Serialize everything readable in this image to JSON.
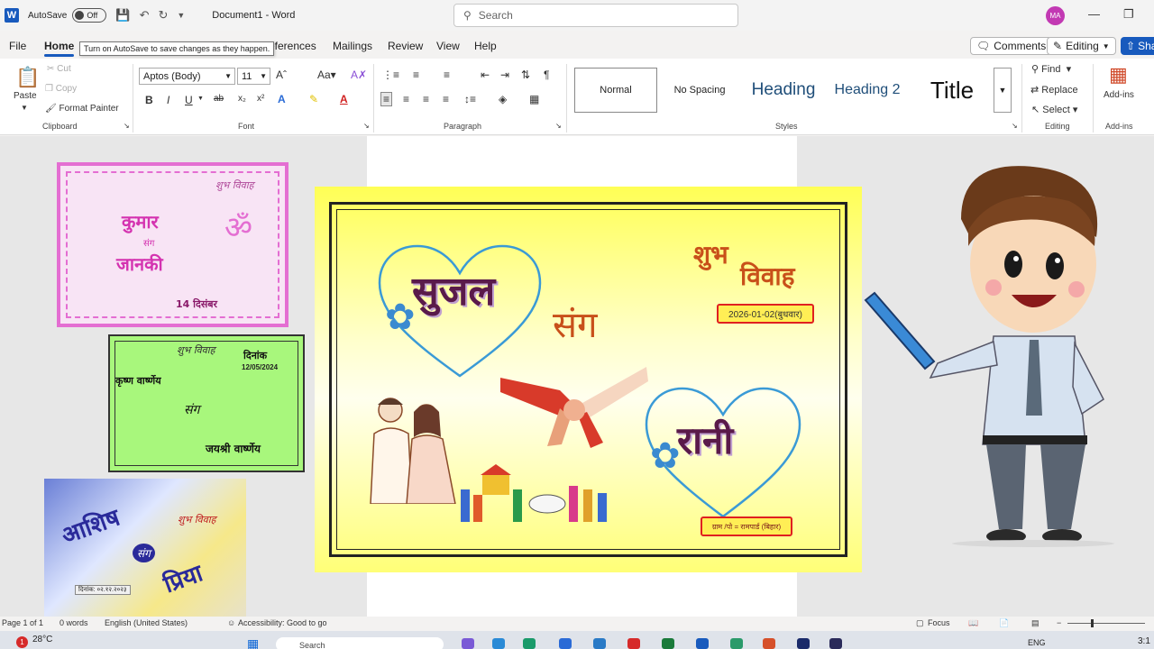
{
  "titlebar": {
    "autosave_label": "AutoSave",
    "autosave_state": "Off",
    "document_title": "Document1 - Word",
    "search_placeholder": "Search",
    "user_initials": "MA"
  },
  "tooltip": "Turn on AutoSave to save changes as they happen.",
  "menu": {
    "tabs": [
      "File",
      "Home",
      "References",
      "Mailings",
      "Review",
      "View",
      "Help"
    ],
    "references_visible_fragment": "eferences",
    "active": "Home",
    "comments_label": "Comments",
    "editing_label": "Editing",
    "share_label": "Sha"
  },
  "ribbon": {
    "clipboard": {
      "label": "Clipboard",
      "paste": "Paste",
      "cut": "Cut",
      "copy": "Copy",
      "format_painter": "Format Painter"
    },
    "font": {
      "label": "Font",
      "family": "Aptos (Body)",
      "size": "11"
    },
    "paragraph": {
      "label": "Paragraph"
    },
    "styles": {
      "label": "Styles",
      "items": [
        "Normal",
        "No Spacing",
        "Heading",
        "Heading 2",
        "Title"
      ]
    },
    "editing": {
      "label": "Editing",
      "find": "Find",
      "replace": "Replace",
      "select": "Select"
    },
    "addins": {
      "button": "Add-ins",
      "label": "Add-ins"
    }
  },
  "cards": {
    "pink": {
      "top_right": "शुभ विवाह",
      "groom": "कुमार",
      "joiner": "संग",
      "bride": "जानकी",
      "date": "14 दिसंबर"
    },
    "green": {
      "heading": "शुभ विवाह",
      "date_label": "दिनांक",
      "date": "12/05/2024",
      "groom": "कृष्ण वार्ष्णेय",
      "joiner": "संग",
      "bride": "जयश्री वार्ष्णेय"
    },
    "blue": {
      "groom": "आशिष",
      "joiner": "संग",
      "heading": "शुभ विवाह",
      "bride": "प्रिया",
      "date": "दिनांक: ०२.१२.२०२३"
    },
    "main": {
      "heading_line1": "शुभ",
      "heading_line2": "विवाह",
      "groom": "सुजल",
      "joiner": "संग",
      "bride": "रानी",
      "date": "2026-01-02(बुधवार)",
      "address": "ग्राम /पो = रामपार्ड (बिहार)"
    }
  },
  "statusbar": {
    "page": "Page 1 of 1",
    "words": "0 words",
    "language": "English (United States)",
    "accessibility": "Accessibility: Good to go",
    "focus": "Focus"
  },
  "taskbar": {
    "weather_badge": "1",
    "temperature": "28°C",
    "search": "Search",
    "lang": "ENG",
    "time": "3:1"
  },
  "colors": {
    "word_blue": "#185abd",
    "main_card_yellow": "#ffff55",
    "pink_card": "#e46ed2",
    "green_card": "#a8f77c",
    "maroon_text": "#5a1a4a",
    "orange_text": "#c8501a"
  }
}
